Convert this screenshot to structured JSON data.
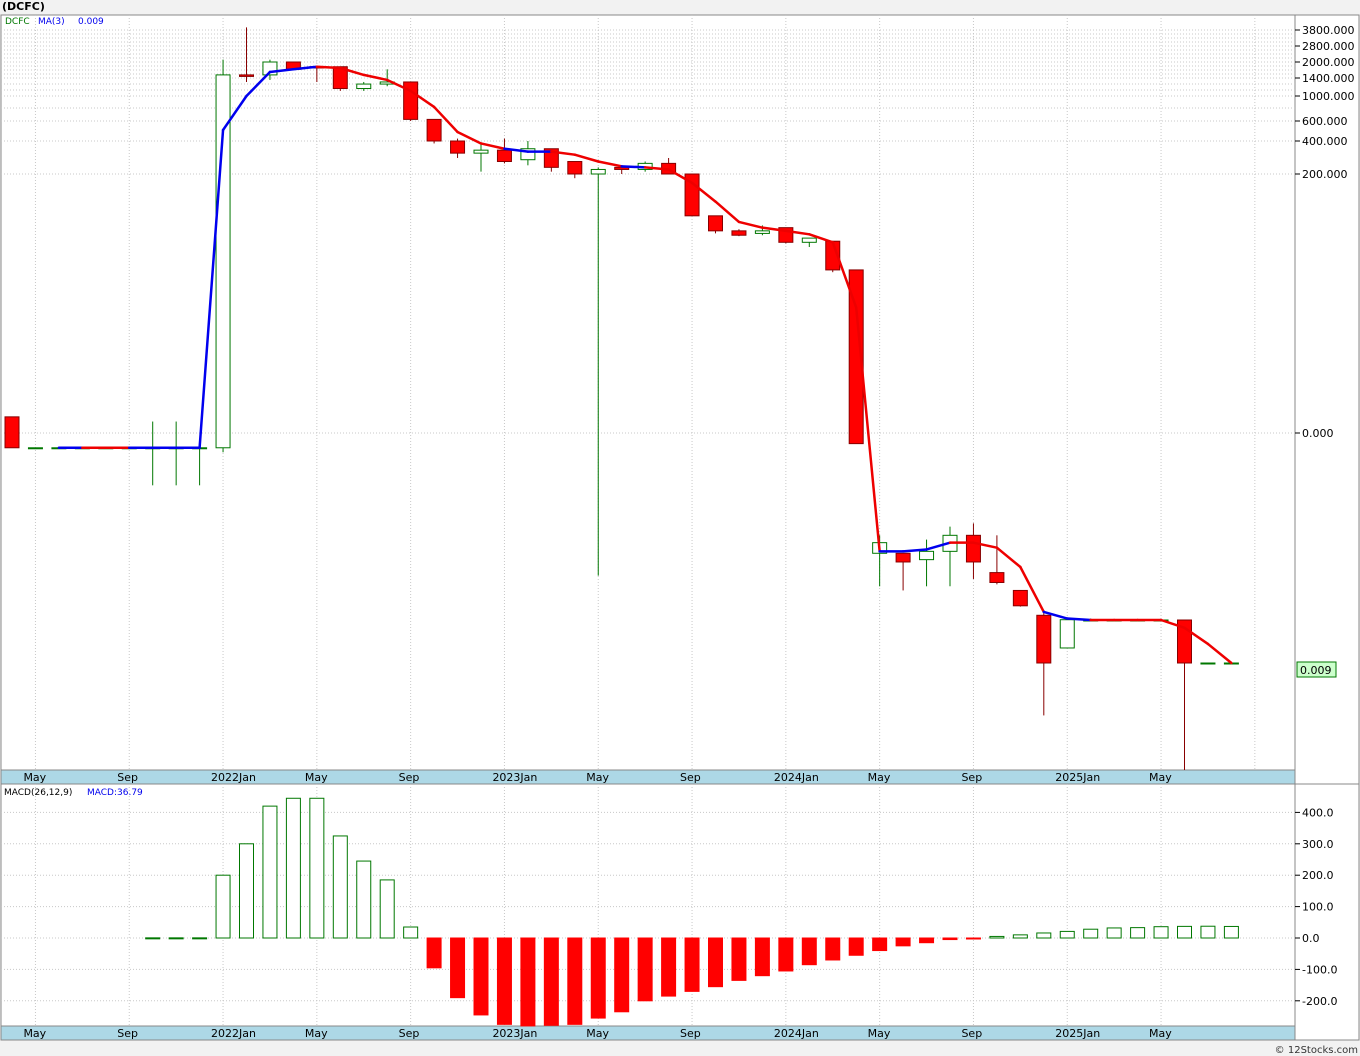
{
  "title": "(DCFC)",
  "credit": "© 12Stocks.com",
  "price_panel": {
    "symbol_label": "DCFC",
    "ma_label": "MA(3)",
    "ma_value": "0.009",
    "last_price_label": "0.009",
    "y_tick_labels": [
      "3800.000",
      "2800.000",
      "2000.000",
      "1400.000",
      "1000.000",
      "600.000",
      "400.000",
      "200.000",
      "0.000",
      "0.009"
    ]
  },
  "macd_panel": {
    "label": "MACD(26,12,9)",
    "value_label": "MACD:36.79",
    "y_tick_labels": [
      "400.0",
      "300.0",
      "200.0",
      "100.0",
      "0.0",
      "-100.0",
      "-200.0"
    ]
  },
  "x_axis_labels": [
    "May",
    "Sep",
    "2022Jan",
    "May",
    "Sep",
    "2023Jan",
    "May",
    "Sep",
    "2024Jan",
    "May",
    "Sep",
    "2025Jan",
    "May"
  ],
  "colors": {
    "up": "#007700",
    "down": "#ff0000",
    "ma_up": "#0000ee",
    "ma_down": "#ee0000",
    "axis_bar": "#add8e6",
    "grid": "#bbbbbb"
  },
  "chart_data": {
    "type": "candlestick",
    "scale": "log",
    "candles": [
      {
        "o": 0.45,
        "h": 0.45,
        "l": 0.22,
        "c": 0.22
      },
      {
        "o": 0.22,
        "h": 0.22,
        "l": 0.22,
        "c": 0.22
      },
      {
        "o": 0.22,
        "h": 0.22,
        "l": 0.22,
        "c": 0.22
      },
      {
        "o": 0.22,
        "h": 0.22,
        "l": 0.22,
        "c": 0.22
      },
      {
        "o": 0.22,
        "h": 0.22,
        "l": 0.22,
        "c": 0.22
      },
      {
        "o": 0.22,
        "h": 0.22,
        "l": 0.22,
        "c": 0.22
      },
      {
        "o": 0.22,
        "h": 0.4,
        "l": 0.1,
        "c": 0.22
      },
      {
        "o": 0.22,
        "h": 0.4,
        "l": 0.1,
        "c": 0.22
      },
      {
        "o": 0.22,
        "h": 0.22,
        "l": 0.1,
        "c": 0.22
      },
      {
        "o": 0.22,
        "h": 2100,
        "l": 0.2,
        "c": 1500
      },
      {
        "o": 1500,
        "h": 4000,
        "l": 1300,
        "c": 1450
      },
      {
        "o": 1500,
        "h": 2100,
        "l": 1350,
        "c": 2000
      },
      {
        "o": 2000,
        "h": 2000,
        "l": 1700,
        "c": 1700
      },
      {
        "o": 1800,
        "h": 1850,
        "l": 1300,
        "c": 1750
      },
      {
        "o": 1800,
        "h": 1800,
        "l": 1100,
        "c": 1150
      },
      {
        "o": 1150,
        "h": 1300,
        "l": 1100,
        "c": 1250
      },
      {
        "o": 1250,
        "h": 1700,
        "l": 1200,
        "c": 1300
      },
      {
        "o": 1300,
        "h": 1300,
        "l": 600,
        "c": 620
      },
      {
        "o": 620,
        "h": 620,
        "l": 380,
        "c": 400
      },
      {
        "o": 400,
        "h": 420,
        "l": 280,
        "c": 310
      },
      {
        "o": 310,
        "h": 380,
        "l": 210,
        "c": 330
      },
      {
        "o": 330,
        "h": 420,
        "l": 250,
        "c": 260
      },
      {
        "o": 270,
        "h": 400,
        "l": 240,
        "c": 340
      },
      {
        "o": 340,
        "h": 340,
        "l": 210,
        "c": 230
      },
      {
        "o": 260,
        "h": 260,
        "l": 180,
        "c": 200
      },
      {
        "o": 200,
        "h": 230,
        "l": 0.015,
        "c": 220
      },
      {
        "o": 230,
        "h": 240,
        "l": 200,
        "c": 220
      },
      {
        "o": 220,
        "h": 260,
        "l": 210,
        "c": 250
      },
      {
        "o": 250,
        "h": 280,
        "l": 200,
        "c": 200
      },
      {
        "o": 200,
        "h": 200,
        "l": 70,
        "c": 70
      },
      {
        "o": 70,
        "h": 70,
        "l": 45,
        "c": 48
      },
      {
        "o": 48,
        "h": 50,
        "l": 42,
        "c": 43
      },
      {
        "o": 45,
        "h": 55,
        "l": 43,
        "c": 48
      },
      {
        "o": 52,
        "h": 52,
        "l": 35,
        "c": 36
      },
      {
        "o": 36,
        "h": 40,
        "l": 32,
        "c": 40
      },
      {
        "o": 37,
        "h": 37,
        "l": 17,
        "c": 18
      },
      {
        "o": 18,
        "h": 18,
        "l": 0.25,
        "c": 0.24
      },
      {
        "o": 0.024,
        "h": 0.035,
        "l": 0.012,
        "c": 0.03
      },
      {
        "o": 0.024,
        "h": 0.024,
        "l": 0.011,
        "c": 0.02
      },
      {
        "o": 0.021,
        "h": 0.032,
        "l": 0.012,
        "c": 0.025
      },
      {
        "o": 0.025,
        "h": 0.042,
        "l": 0.012,
        "c": 0.035
      },
      {
        "o": 0.035,
        "h": 0.045,
        "l": 0.014,
        "c": 0.02
      },
      {
        "o": 0.016,
        "h": 0.035,
        "l": 0.0125,
        "c": 0.013
      },
      {
        "o": 0.011,
        "h": 0.011,
        "l": 0.0018,
        "c": 0.0022
      },
      {
        "o": 0.00022,
        "h": 0.0008,
        "l": 1.1e-06,
        "c": 1.1e-05
      },
      {
        "o": 2.1e-05,
        "h": 2.1e-05,
        "l": 2.1e-05,
        "c": 7.5e-05
      },
      {
        "o": 7e-05,
        "h": 0.0001,
        "l": 7e-05,
        "c": 7e-05
      },
      {
        "o": 7e-05,
        "h": 7e-05,
        "l": 7e-05,
        "c": 7e-05
      },
      {
        "o": 7e-05,
        "h": 7e-05,
        "l": 7e-05,
        "c": 7e-05
      },
      {
        "o": 7e-05,
        "h": 7e-05,
        "l": 7e-05,
        "c": 7e-05
      },
      {
        "o": 7e-05,
        "h": 7e-05,
        "l": 1e-07,
        "c": 1.1e-05
      },
      {
        "o": 1.1e-05,
        "h": 1.1e-05,
        "l": 1.1e-05,
        "c": 1.1e-05
      },
      {
        "o": 1.1e-05,
        "h": 1.1e-05,
        "l": 1.1e-05,
        "c": 1.1e-05
      }
    ],
    "ma": [
      null,
      null,
      0.22,
      0.22,
      0.22,
      0.22,
      0.22,
      0.22,
      0.22,
      500,
      1000,
      1600,
      1700,
      1800,
      1750,
      1500,
      1350,
      1100,
      800,
      480,
      380,
      340,
      320,
      320,
      300,
      260,
      235,
      230,
      220,
      160,
      100,
      60,
      52,
      48,
      44,
      36,
      7,
      0.025,
      0.025,
      0.026,
      0.03,
      0.03,
      0.027,
      0.018,
      0.0005,
      0.0001,
      7e-05,
      7e-05,
      7e-05,
      7e-05,
      5e-05,
      2.5e-05,
      1.1e-05
    ],
    "ma_direction": [
      "",
      "",
      "d",
      "u",
      "d",
      "d",
      "u",
      "u",
      "u",
      "u",
      "u",
      "u",
      "u",
      "u",
      "d",
      "d",
      "d",
      "d",
      "d",
      "d",
      "d",
      "d",
      "u",
      "u",
      "d",
      "d",
      "d",
      "u",
      "d",
      "d",
      "d",
      "d",
      "d",
      "d",
      "d",
      "d",
      "d",
      "d",
      "u",
      "u",
      "u",
      "d",
      "d",
      "d",
      "d",
      "u",
      "u",
      "d",
      "d",
      "d",
      "d",
      "d",
      "d"
    ],
    "macd": [
      0,
      0,
      0,
      0,
      0,
      0,
      0,
      0,
      0,
      0,
      0,
      0,
      0,
      0,
      0,
      0,
      0,
      0,
      0,
      0,
      0,
      0,
      0,
      0,
      0,
      0,
      0,
      0,
      0,
      0,
      0,
      0,
      0,
      0,
      0,
      0,
      0,
      0,
      0,
      0,
      0,
      0,
      0,
      0,
      0,
      0,
      0,
      0,
      0,
      0,
      0,
      0,
      0
    ],
    "macd_hist": [
      null,
      null,
      null,
      null,
      null,
      null,
      0.5,
      0.5,
      0.5,
      200,
      300,
      420,
      445,
      445,
      325,
      245,
      185,
      35,
      -95,
      -190,
      -245,
      -275,
      -280,
      -278,
      -275,
      -255,
      -235,
      -200,
      -185,
      -170,
      -155,
      -135,
      -120,
      -105,
      -85,
      -70,
      -55,
      -40,
      -25,
      -15,
      -5,
      -2,
      5,
      10,
      16,
      21,
      28,
      32,
      33,
      36,
      37,
      37.5,
      36.79
    ],
    "x_tick_positions_index": [
      1,
      5,
      9,
      13,
      17,
      21,
      25,
      29,
      33,
      37,
      41,
      45,
      49
    ]
  }
}
